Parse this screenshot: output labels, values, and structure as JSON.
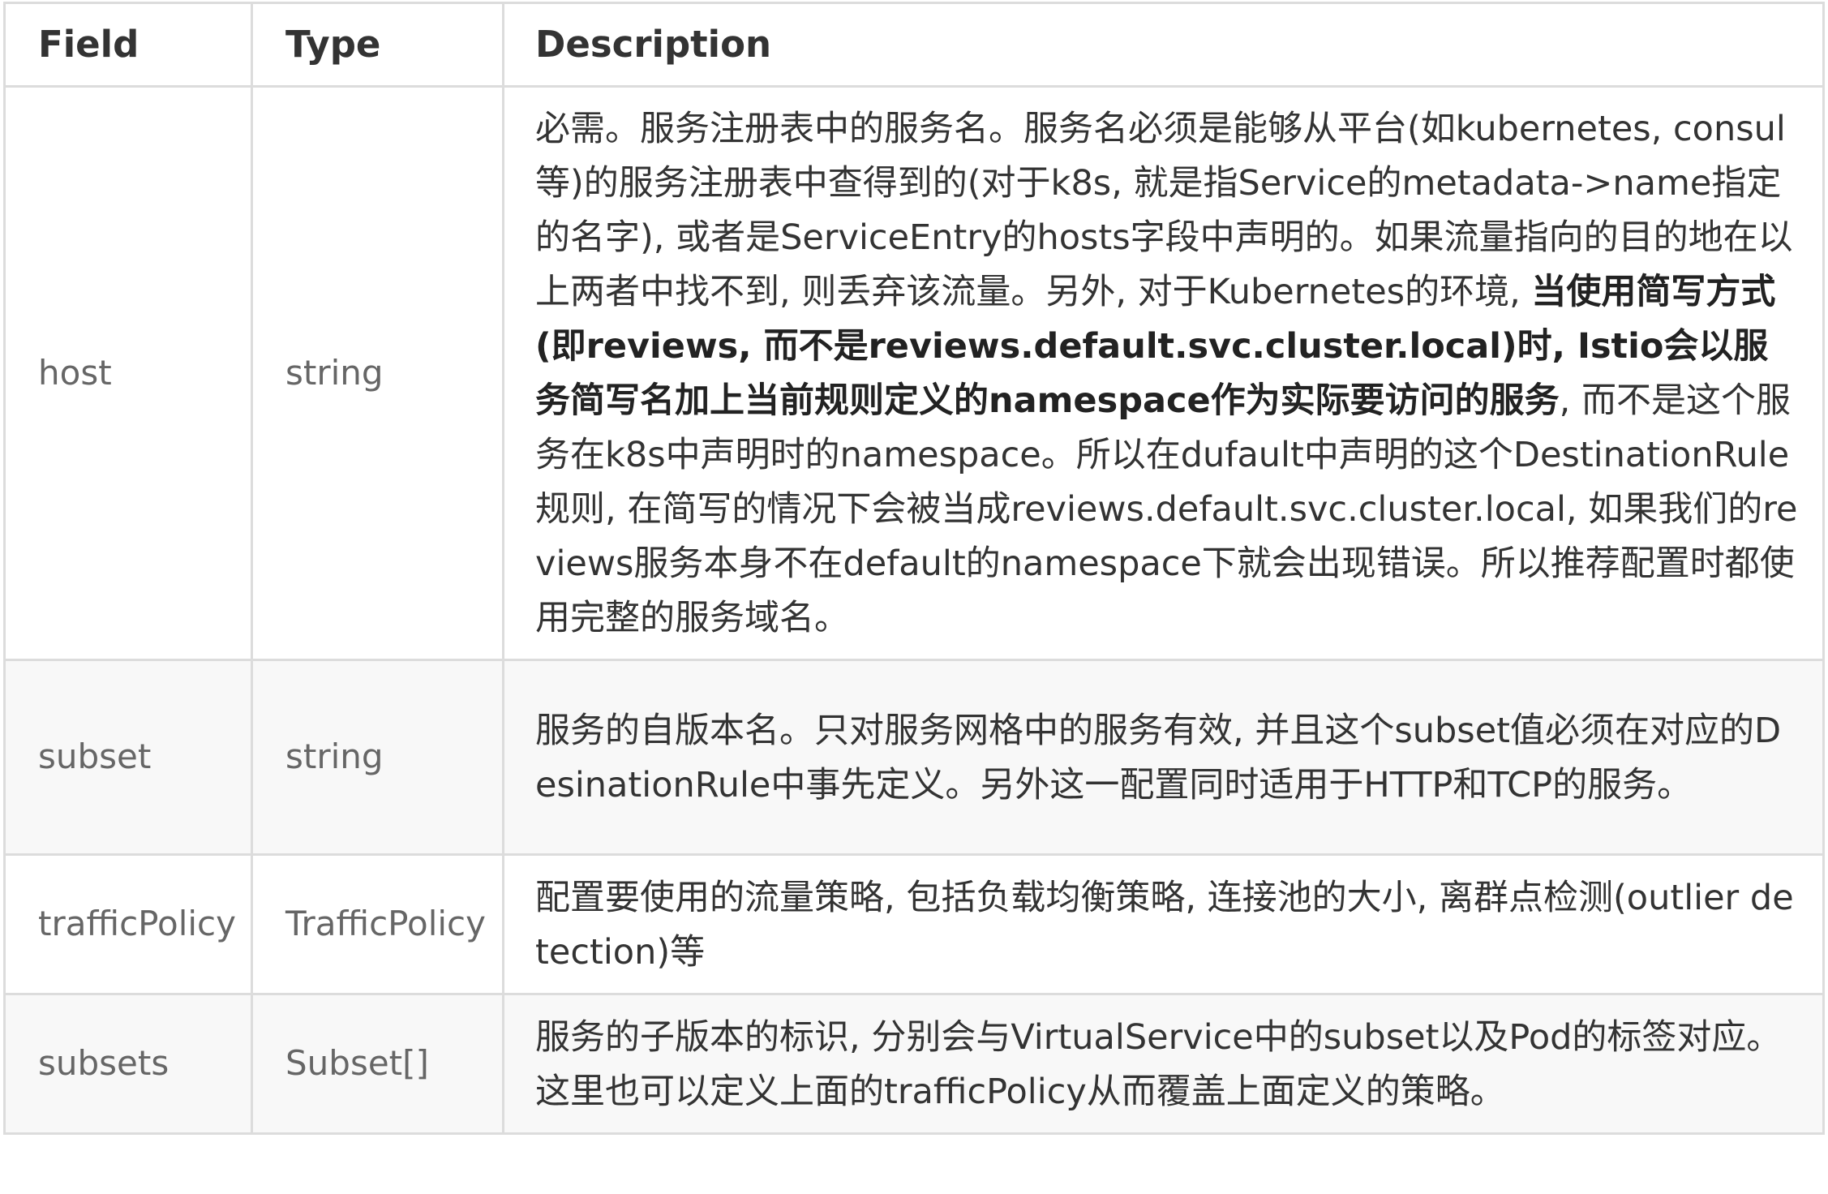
{
  "table": {
    "headers": {
      "field": "Field",
      "type": "Type",
      "description": "Description"
    },
    "rows": [
      {
        "field": "host",
        "type": "string",
        "desc_part1": "必需。服务注册表中的服务名。服务名必须是能够从平台(如kubernetes, consul等)的服务注册表中查得到的(对于k8s, 就是指Service的metadata->name指定的名字), 或者是ServiceEntry的hosts字段中声明的。如果流量指向的目的地在以上两者中找不到, 则丢弃该流量。另外, 对于Kubernetes的环境, ",
        "desc_bold": "当使用简写方式(即reviews, 而不是reviews.default.svc.cluster.local)时, Istio会以服务简写名加上当前规则定义的namespace作为实际要访问的服务",
        "desc_part2": ", 而不是这个服务在k8s中声明时的namespace。所以在dufault中声明的这个DestinationRule规则, 在简写的情况下会被当成reviews.default.svc.cluster.local, 如果我们的reviews服务本身不在default的namespace下就会出现错误。所以推荐配置时都使用完整的服务域名。"
      },
      {
        "field": "subset",
        "type": "string",
        "description": "服务的自版本名。只对服务网格中的服务有效, 并且这个subset值必须在对应的DesinationRule中事先定义。另外这一配置同时适用于HTTP和TCP的服务。"
      },
      {
        "field": "trafficPolicy",
        "type": "TrafficPolicy",
        "description": "配置要使用的流量策略, 包括负载均衡策略, 连接池的大小, 离群点检测(outlier detection)等"
      },
      {
        "field": "subsets",
        "type": "Subset[]",
        "description": "服务的子版本的标识, 分别会与VirtualService中的subset以及Pod的标签对应。这里也可以定义上面的trafficPolicy从而覆盖上面定义的策略。"
      }
    ]
  }
}
